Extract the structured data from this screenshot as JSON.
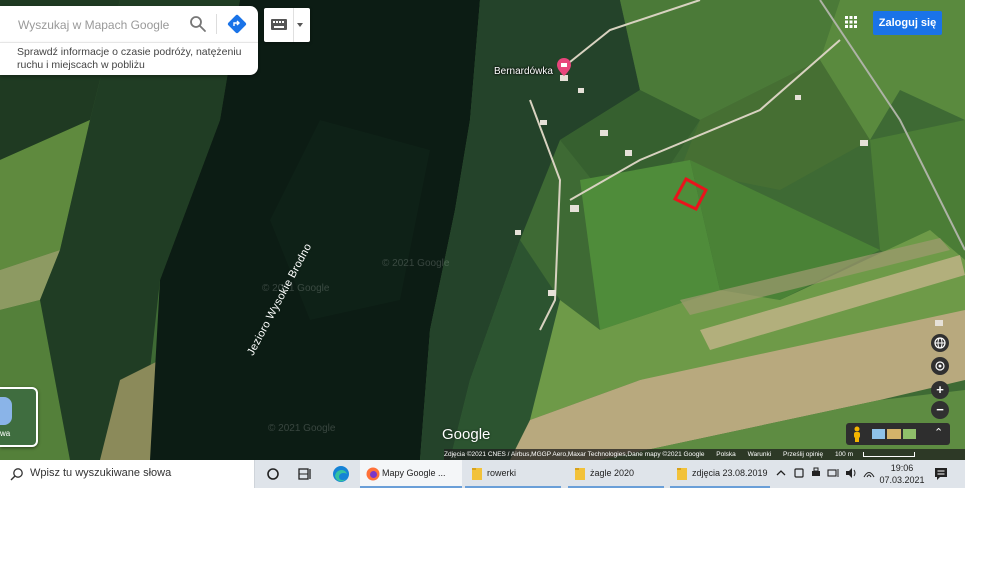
{
  "search": {
    "placeholder": "Wyszukaj w Mapach Google",
    "hint": "Sprawdź informacje o czasie podróży, natężeniu ruchu i miejscach w pobliżu"
  },
  "header": {
    "login_label": "Zaloguj się"
  },
  "map": {
    "poi_label": "Bernardówka",
    "lake_label": "Jezioro Wysokie Brodno",
    "watermark": "© 2021 Google",
    "logo": "Google",
    "layers_label": "wa",
    "zoom_in": "+",
    "zoom_out": "−",
    "expand": "⌃"
  },
  "attribution": {
    "imagery": "Zdjęcia ©2021 CNES / Airbus,MGGP Aero,Maxar Technologies,Dane mapy ©2021 Google",
    "country": "Polska",
    "terms": "Warunki",
    "feedback": "Prześlij opinię",
    "scale": "100 m"
  },
  "taskbar": {
    "search_text": "Wpisz tu wyszukiwane słowa",
    "tasks": [
      {
        "label": "Mapy Google ..."
      },
      {
        "label": "rowerki"
      },
      {
        "label": "żagle 2020"
      },
      {
        "label": "zdjęcia 23.08.2019"
      }
    ],
    "time": "19:06",
    "date": "07.03.2021"
  },
  "colors": {
    "login_button": "#1a73e8",
    "boundary": "#e8141c",
    "pin": "#e8457c",
    "lake": "#0c1c14",
    "forest": "#1f3a22",
    "field": "#5f8a3e",
    "bare_field": "#b8a97e"
  }
}
